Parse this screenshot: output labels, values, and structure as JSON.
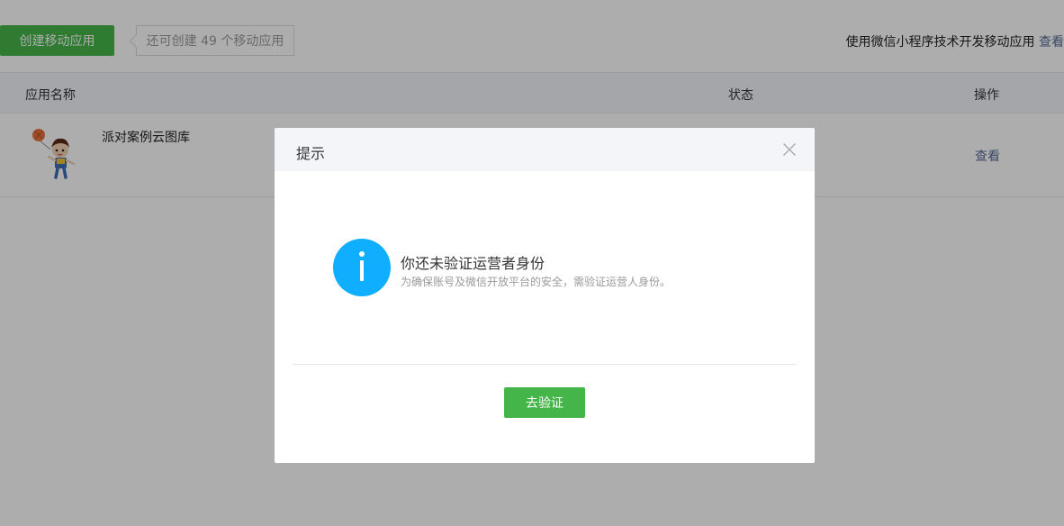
{
  "toolbar": {
    "create_button": "创建移动应用",
    "quota_tip": "还可创建 49 个移动应用",
    "miniprogram_hint": "使用微信小程序技术开发移动应用",
    "miniprogram_link": "查看"
  },
  "table": {
    "columns": [
      "应用名称",
      "状态",
      "操作"
    ],
    "rows": [
      {
        "app_name": "派对案例云图库",
        "status": "",
        "action": "查看"
      }
    ]
  },
  "dialog": {
    "title": "提示",
    "message_title": "你还未验证运营者身份",
    "message_desc": "为确保账号及微信开放平台的安全，需验证运营人身份。",
    "confirm_button": "去验证"
  },
  "colors": {
    "primary_green": "#44b549",
    "link_blue": "#576b95",
    "info_blue": "#10aeff",
    "header_gray": "#f4f5f9"
  },
  "icons": {
    "close": "close-icon",
    "info": "info-icon",
    "app": "app-icon"
  }
}
